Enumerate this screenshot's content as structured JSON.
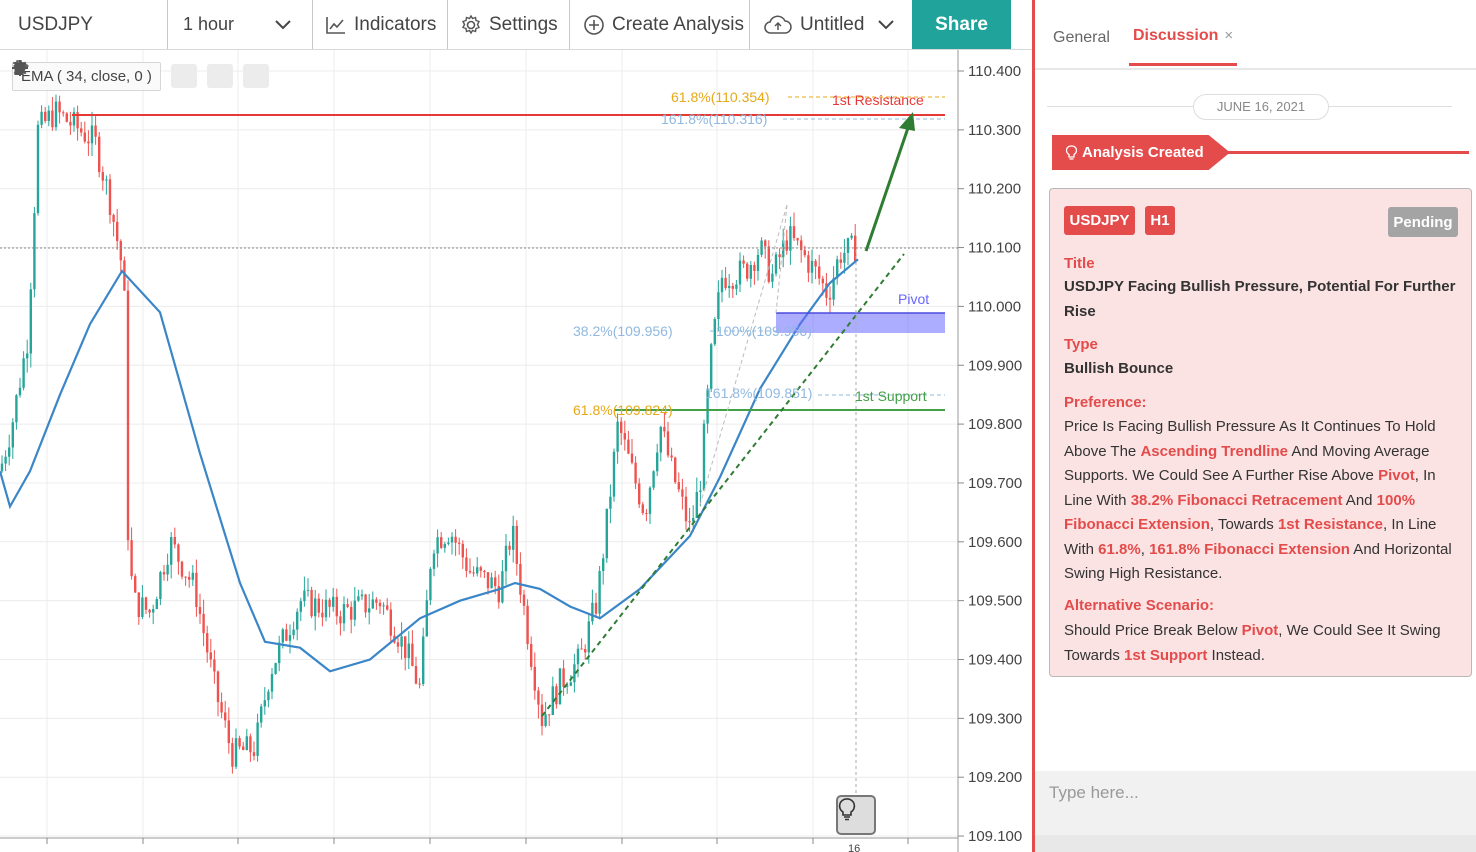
{
  "toolbar": {
    "symbol": "USDJPY",
    "interval": "1 hour",
    "indicators_label": "Indicators",
    "settings_label": "Settings",
    "create_analysis_label": "Create Analysis",
    "untitled_label": "Untitled",
    "share_label": "Share"
  },
  "chart": {
    "ema_label": "EMA ( 34, close, 0 )",
    "y_ticks": [
      "110.400",
      "110.300",
      "110.200",
      "110.100",
      "110.000",
      "109.900",
      "109.800",
      "109.700",
      "109.600",
      "109.500",
      "109.400",
      "109.300",
      "109.200",
      "109.100"
    ],
    "x_ticks": [
      "16"
    ],
    "annotations": {
      "fib_618_top": "61.8%(110.354)",
      "fib_1618_top": "161.8%(110.316)",
      "resistance": "1st Resistance",
      "pivot": "Pivot",
      "fib_382": "38.2%(109.956)",
      "fib_100": "100%(109.956)",
      "fib_1618_mid": "161.8%(109.851)",
      "support": "1st Support",
      "fib_618_bottom": "61.8%(109.824)"
    },
    "colors": {
      "bull": "#26a69a",
      "bear": "#ef5350",
      "ema": "#3a86c8",
      "resistance": "#e53935",
      "support": "#43a047",
      "pivot": "#6666ff",
      "fib_gold": "#e6a817",
      "fib_blue": "#90b8e0",
      "trend": "#2e7d32"
    }
  },
  "sidebar": {
    "tabs": {
      "general": "General",
      "discussion": "Discussion",
      "close": "×"
    },
    "date": "JUNE 16, 2021",
    "created_label": "Analysis Created",
    "card": {
      "symbol": "USDJPY",
      "timeframe": "H1",
      "status": "Pending",
      "title_label": "Title",
      "title": "USDJPY Facing Bullish Pressure, Potential For Further Rise",
      "type_label": "Type",
      "type": "Bullish Bounce",
      "preference_label": "Preference:",
      "preference": {
        "p1": "Price Is Facing Bullish Pressure As It Continues To Hold Above The ",
        "h1": "Ascending Trendline",
        "p2": " And Moving Average Supports. We Could See A Further Rise Above ",
        "h2": "Pivot",
        "p3": ", In Line With ",
        "h3": "38.2% Fibonacci Retracement",
        "p4": " And ",
        "h4": "100% Fibonacci Extension",
        "p5": ", Towards ",
        "h5": "1st Resistance",
        "p6": ", In Line With ",
        "h6": "61.8%",
        "p7": ", ",
        "h7": "161.8% Fibonacci Extension",
        "p8": " And Horizontal Swing High Resistance."
      },
      "alt_label": "Alternative Scenario:",
      "alt": {
        "p1": "Should Price Break Below ",
        "h1": "Pivot",
        "p2": ", We Could See It Swing Towards ",
        "h2": "1st Support",
        "p3": " Instead."
      }
    },
    "chat_placeholder": "Type here..."
  }
}
